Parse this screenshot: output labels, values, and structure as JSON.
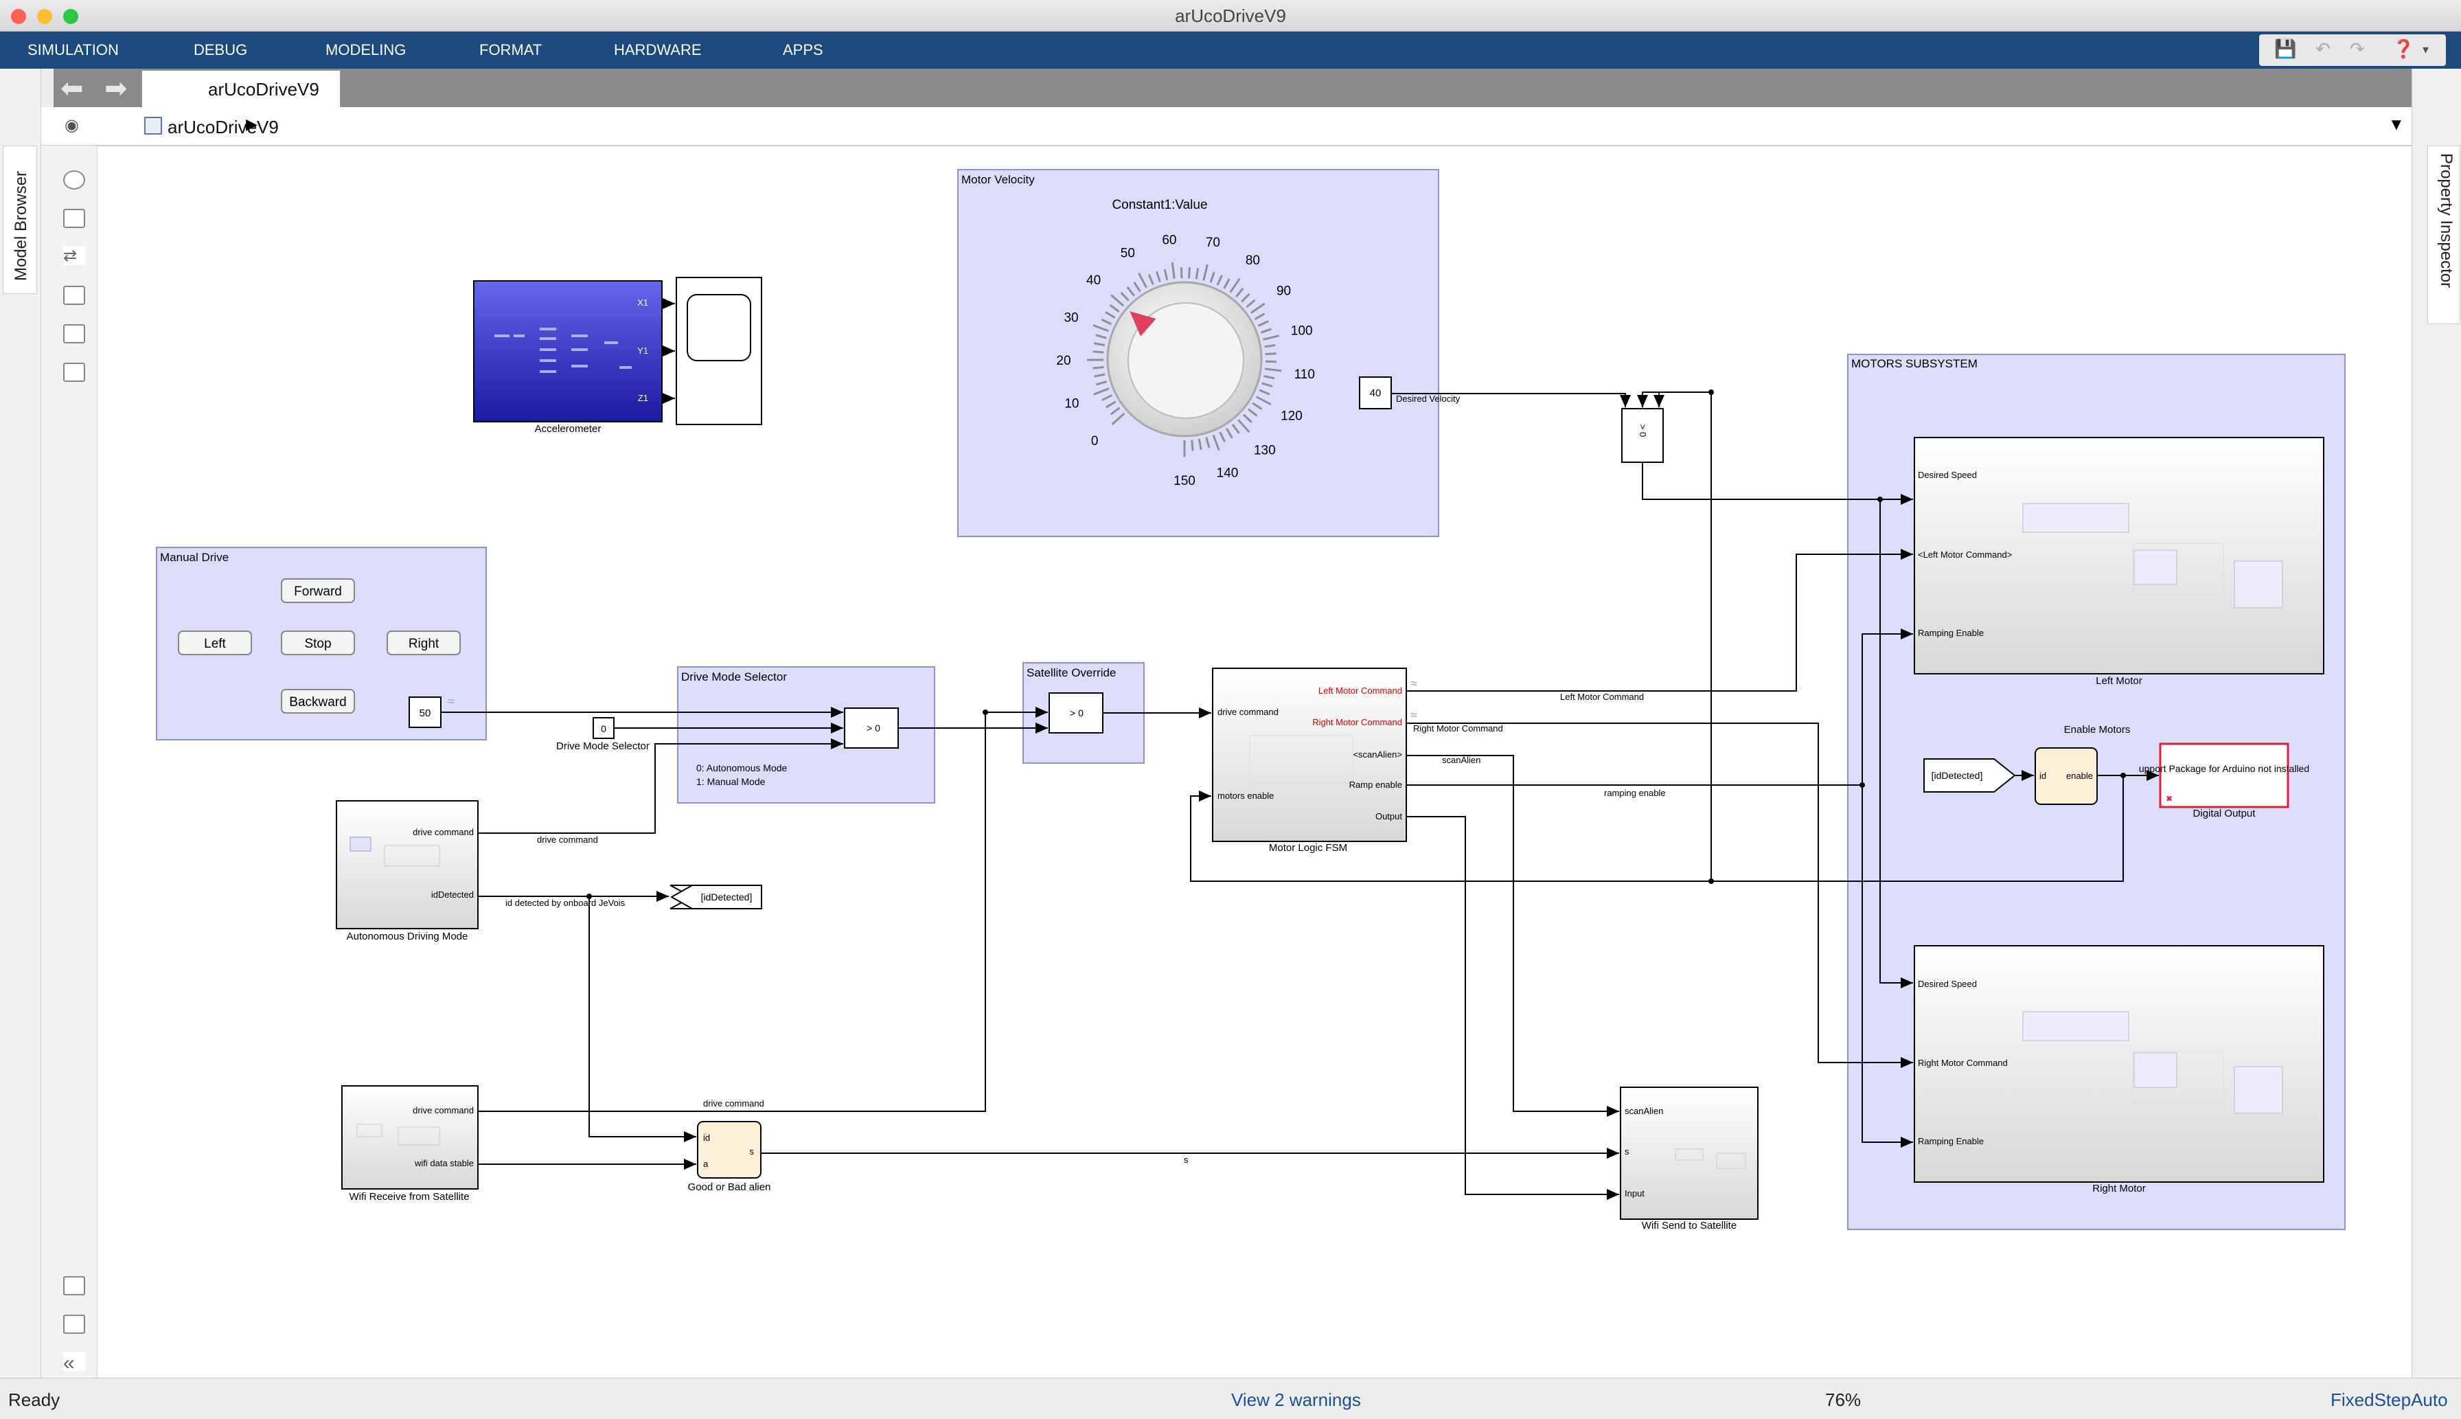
{
  "window": {
    "title": "arUcoDriveV9"
  },
  "menu": [
    "SIMULATION",
    "DEBUG",
    "MODELING",
    "FORMAT",
    "HARDWARE",
    "APPS"
  ],
  "tab": {
    "label": "arUcoDriveV9"
  },
  "breadcrumb": {
    "label": "arUcoDriveV9"
  },
  "docks": {
    "left": "Model Browser",
    "right": "Property Inspector"
  },
  "status": {
    "ready": "Ready",
    "warnings": "View 2 warnings",
    "zoom": "76%",
    "solver": "FixedStepAuto"
  },
  "colors": {
    "menubar": "#1b4a7c",
    "area": "#dcdcfb",
    "areaBorder": "#9090d0",
    "warning": "#1a4f9c",
    "errorRed": "#e0203a"
  },
  "model": {
    "motor_velocity": {
      "title": "Motor Velocity",
      "knob_label": "Constant1:Value",
      "ticks": [
        "0",
        "10",
        "20",
        "30",
        "40",
        "50",
        "60",
        "70",
        "80",
        "90",
        "100",
        "110",
        "120",
        "130",
        "140",
        "150"
      ],
      "knob_value": 40
    },
    "desired_velocity": {
      "value": "40",
      "label": "Desired Velocity"
    },
    "accelerometer": {
      "label": "Accelerometer",
      "ports": [
        "X1",
        "Y1",
        "Z1"
      ]
    },
    "manual_drive": {
      "title": "Manual Drive",
      "buttons": [
        "Forward",
        "Left",
        "Stop",
        "Right",
        "Backward"
      ],
      "value": "50"
    },
    "drive_mode_selector": {
      "title": "Drive Mode Selector",
      "constant": "0",
      "label": "Drive Mode Selector",
      "note1": "0: Autonomous Mode",
      "note2": "1: Manual Mode",
      "switch": "> 0"
    },
    "satellite_override": {
      "title": "Satellite Override",
      "switch": "> 0"
    },
    "autonomous": {
      "label": "Autonomous Driving Mode",
      "ports": [
        "drive command",
        "idDetected"
      ]
    },
    "wifi_receive": {
      "label": "Wifi Receive from Satellite",
      "ports": [
        "drive command",
        "wifi data stable"
      ]
    },
    "good_bad": {
      "label": "Good or Bad alien",
      "in": [
        "id",
        "a"
      ],
      "out": "s"
    },
    "id_goto": {
      "tag": "[idDetected]"
    },
    "fsm": {
      "label": "Motor Logic FSM",
      "in": [
        "drive command",
        "motors enable"
      ],
      "out": [
        "Left Motor Command",
        "Right Motor Command",
        "<scanAlien>",
        "Ramp enable",
        "Output"
      ]
    },
    "wifi_send": {
      "label": "Wifi Send to Satellite",
      "in": [
        "scanAlien",
        "s",
        "Input"
      ]
    },
    "motors": {
      "title": "MOTORS SUBSYSTEM",
      "left_label": "Left Motor",
      "left_ports": [
        "Desired Speed",
        "<Left Motor Command>",
        "Ramping Enable"
      ],
      "right_label": "Right Motor",
      "right_ports": [
        "Desired Speed",
        "Right Motor Command",
        "Ramping Enable"
      ],
      "enable_title": "Enable Motors",
      "enable_from": "[idDetected]",
      "enable_ports": [
        "id",
        "enable"
      ],
      "digital_text": "upport Package for Arduino not installed",
      "digital_label": "Digital Output"
    },
    "signals": {
      "drive_command": "drive command",
      "id_detected": "id detected by onboard JeVois",
      "left_cmd": "Left Motor Command",
      "right_cmd": "Right Motor Command",
      "scan": "scanAlien",
      "ramp": "ramping enable",
      "s": "s",
      "drive_command2": "drive command"
    }
  }
}
